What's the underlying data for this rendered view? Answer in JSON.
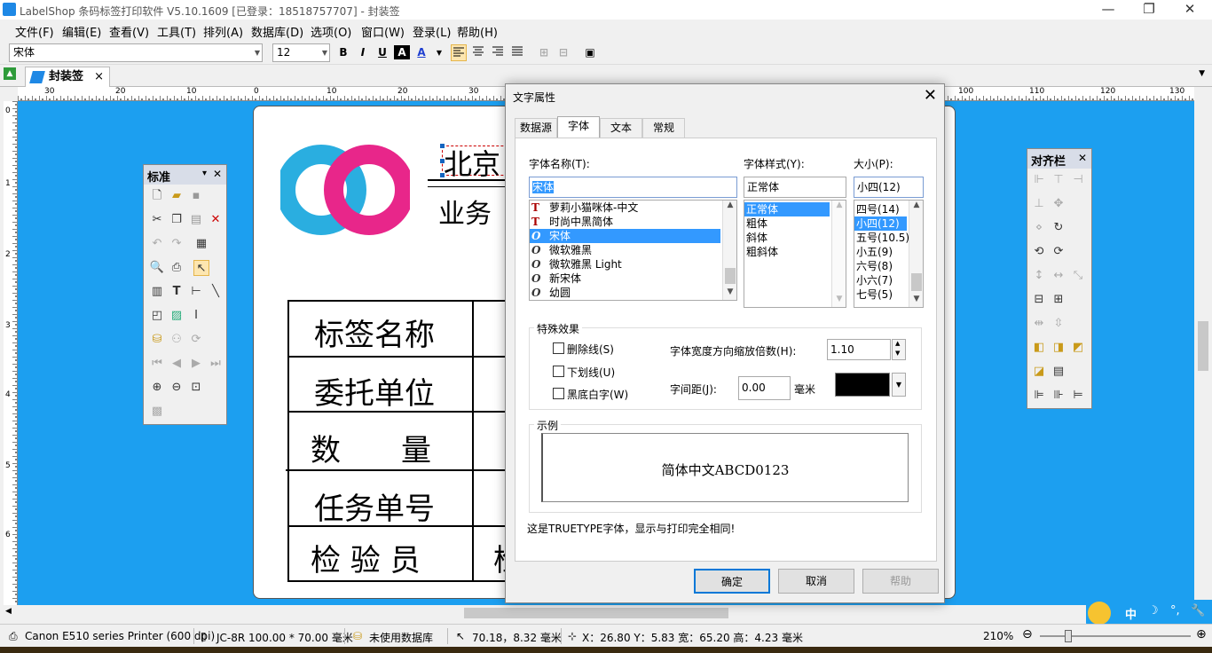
{
  "window": {
    "title": "LabelShop 条码标签打印软件 V5.10.1609  [已登录：18518757707] - 封装签",
    "minimize": "—",
    "restore": "❐",
    "close": "✕"
  },
  "menu": [
    "文件(F)",
    "编辑(E)",
    "查看(V)",
    "工具(T)",
    "排列(A)",
    "数据库(D)",
    "选项(O)",
    "窗口(W)",
    "登录(L)",
    "帮助(H)"
  ],
  "toolbar": {
    "font": "宋体",
    "size": "12",
    "bold": "B",
    "italic": "I",
    "underline": "U",
    "bgtext": "A",
    "color": "A",
    "color_hex": "#1f3fd0"
  },
  "doc_tab": {
    "label": "封装签",
    "close": "×"
  },
  "ruler_h": [
    "30",
    "20",
    "10",
    "0",
    "10",
    "20",
    "30",
    "100",
    "110",
    "120",
    "130"
  ],
  "ruler_v": [
    "0",
    "1",
    "2",
    "3",
    "4",
    "5",
    "6"
  ],
  "label": {
    "company": "北京",
    "business": "业务",
    "rows": [
      "标签名称",
      "委托单位",
      "数　　量",
      "任务单号",
      "检 验 员"
    ],
    "cut1": "1",
    "cut2": "1",
    "cut3": "检",
    "logo_colors": {
      "pink": "#e8268a",
      "blue": "#2aaee0"
    }
  },
  "panel_standard": {
    "title": "标准",
    "close": "✕",
    "collapse": "▾"
  },
  "panel_align": {
    "title": "对齐栏",
    "close": "✕"
  },
  "dialog": {
    "title": "文字属性",
    "close": "✕",
    "tabs": [
      "数据源",
      "字体",
      "文本",
      "常规"
    ],
    "font_name_label": "字体名称(T):",
    "font_name_value": "宋体",
    "fonts": [
      {
        "icon": "T",
        "name": "萝莉小猫咪体-中文",
        "sel": false
      },
      {
        "icon": "T",
        "name": "时尚中黑简体",
        "sel": false
      },
      {
        "icon": "O",
        "name": "宋体",
        "sel": true
      },
      {
        "icon": "O",
        "name": "微软雅黑",
        "sel": false
      },
      {
        "icon": "O",
        "name": "微软雅黑 Light",
        "sel": false
      },
      {
        "icon": "O",
        "name": "新宋体",
        "sel": false
      },
      {
        "icon": "O",
        "name": "幼圆",
        "sel": false
      }
    ],
    "style_label": "字体样式(Y):",
    "style_value": "正常体",
    "styles": [
      "正常体",
      "粗体",
      "斜体",
      "粗斜体"
    ],
    "size_label": "大小(P):",
    "size_value": "小四(12)",
    "sizes": [
      "四号(14)",
      "小四(12)",
      "五号(10.5)",
      "小五(9)",
      "六号(8)",
      "小六(7)",
      "七号(5)"
    ],
    "effects_label": "特殊效果",
    "strike": "删除线(S)",
    "underline": "下划线(U)",
    "inverse": "黑底白字(W)",
    "scale_label": "字体宽度方向缩放倍数(H):",
    "scale_value": "1.10",
    "spacing_label": "字间距(J):",
    "spacing_value": "0.00",
    "spacing_unit": "毫米",
    "sample_label": "示例",
    "sample_text": "简体中文ABCD0123",
    "note": "这是TRUETYPE字体，显示与打印完全相同!",
    "ok": "确定",
    "cancel": "取消",
    "help": "帮助"
  },
  "status": {
    "printer": "Canon E510 series Printer (600 dpi)",
    "paper": "JC-8R  100.00 * 70.00 毫米",
    "db": "未使用数据库",
    "cursor": "70.18，8.32 毫米",
    "geometry": "X：26.80  Y：5.83  宽：65.20  高：4.23  毫米",
    "zoom": "210%"
  },
  "ime": {
    "mode": "中"
  }
}
